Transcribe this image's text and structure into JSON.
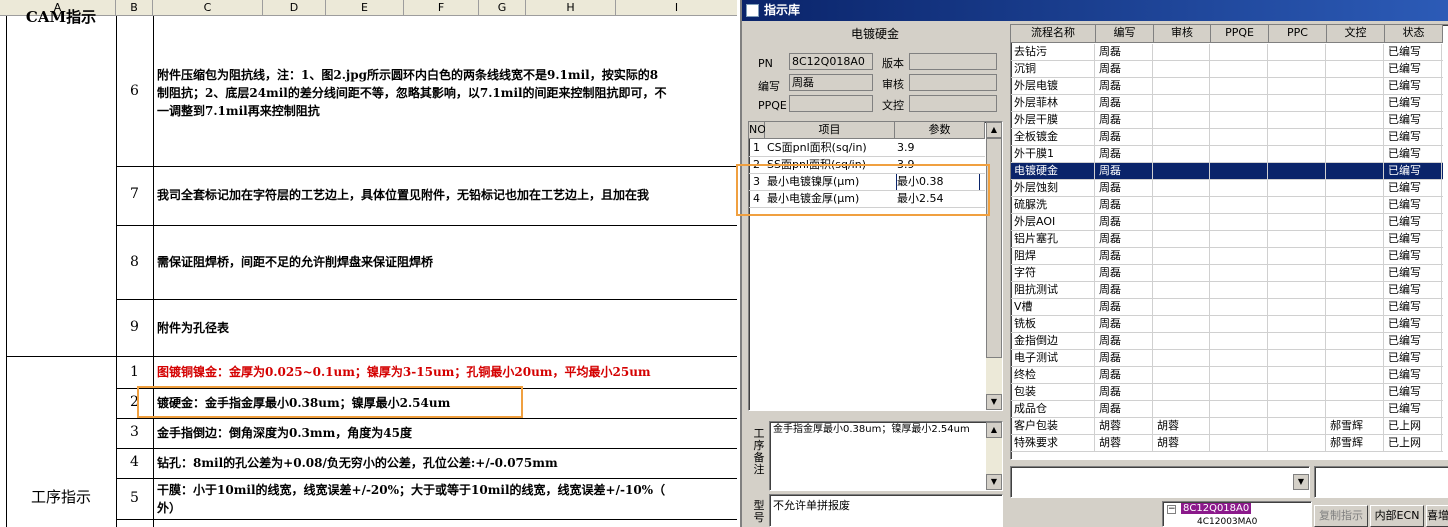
{
  "sheet": {
    "columns": [
      "A",
      "B",
      "C",
      "D",
      "E",
      "F",
      "G",
      "H",
      "I"
    ],
    "top_section_label": "CAM指示",
    "bottom_section_label": "工序指示",
    "upper_rows": [
      {
        "num": "6",
        "line1": "附件压缩包为阻抗线，注：1、图2.jpg所示圆环内白色的两条线线宽不是9.1mil，按实际的8",
        "line2": "制阻抗；2、底层24mil的差分线间距不等，忽略其影响，以7.1mil的间距来控制阻抗即可，不",
        "line3": "一调整到7.1mil再来控制阻抗"
      },
      {
        "num": "7",
        "text": "我司全套标记加在字符层的工艺边上，具体位置见附件，无铅标记也加在工艺边上，且加在我"
      },
      {
        "num": "8",
        "text": "需保证阻焊桥，间距不足的允许削焊盘来保证阻焊桥"
      },
      {
        "num": "9",
        "text": "附件为孔径表"
      }
    ],
    "lower_rows": [
      {
        "num": "1",
        "text": "图镀铜镍金：金厚为0.025~0.1um；镍厚为3-15um；孔铜最小20um，平均最小25um",
        "red": true
      },
      {
        "num": "2",
        "text": "镀硬金：金手指金厚最小0.38um；镍厚最小2.54um"
      },
      {
        "num": "3",
        "text": "金手指倒边：倒角深度为0.3mm，角度为45度"
      },
      {
        "num": "4",
        "text": "钻孔：8mil的孔公差为+0.08/负无穷小的公差，孔位公差:+/-0.075mm"
      },
      {
        "num": "5",
        "text": "干膜：小于10mil的线宽，线宽误差+/-20%；大于或等于10mil的线宽，线宽误差+/-10%（",
        "text2": "外）"
      }
    ]
  },
  "dialog": {
    "title": "指示库",
    "section_title": "电镀硬金",
    "fields": {
      "pn_label": "PN",
      "pn_value": "8C12Q018A0",
      "version_label": "版本",
      "version_value": "",
      "author_label": "编写",
      "author_value": "周磊",
      "review_label": "审核",
      "review_value": "",
      "ppqe_label": "PPQE",
      "ppqe_value": "",
      "control_label": "文控",
      "control_value": ""
    },
    "param_headers": [
      "NO",
      "项目",
      "参数"
    ],
    "params": [
      {
        "no": "1",
        "item": "CS面pnl面积(sq/in)",
        "value": "3.9"
      },
      {
        "no": "2",
        "item": "SS面pnl面积(sq/in)",
        "value": "3.9"
      },
      {
        "no": "3",
        "item": "最小电镀镍厚(μm)",
        "value": "最小0.38"
      },
      {
        "no": "4",
        "item": "最小电镀金厚(μm)",
        "value": "最小2.54"
      }
    ],
    "note_label": "工序备注",
    "note_text": "金手指金厚最小0.38um；镍厚最小2.54um",
    "type_label": "型号",
    "type_text": "不允许单拼报废",
    "flow_headers": [
      "流程名称",
      "编写",
      "审核",
      "PPQE",
      "PPC",
      "文控",
      "状态"
    ],
    "flows": [
      {
        "name": "去钻污",
        "author": "周磊",
        "review": "",
        "ppqe": "",
        "ppc": "",
        "ctrl": "",
        "status": "已编写"
      },
      {
        "name": "沉铜",
        "author": "周磊",
        "review": "",
        "ppqe": "",
        "ppc": "",
        "ctrl": "",
        "status": "已编写"
      },
      {
        "name": "外层电镀",
        "author": "周磊",
        "review": "",
        "ppqe": "",
        "ppc": "",
        "ctrl": "",
        "status": "已编写"
      },
      {
        "name": "外层菲林",
        "author": "周磊",
        "review": "",
        "ppqe": "",
        "ppc": "",
        "ctrl": "",
        "status": "已编写"
      },
      {
        "name": "外层干膜",
        "author": "周磊",
        "review": "",
        "ppqe": "",
        "ppc": "",
        "ctrl": "",
        "status": "已编写"
      },
      {
        "name": "全板镀金",
        "author": "周磊",
        "review": "",
        "ppqe": "",
        "ppc": "",
        "ctrl": "",
        "status": "已编写"
      },
      {
        "name": "外干膜1",
        "author": "周磊",
        "review": "",
        "ppqe": "",
        "ppc": "",
        "ctrl": "",
        "status": "已编写"
      },
      {
        "name": "电镀硬金",
        "author": "周磊",
        "review": "",
        "ppqe": "",
        "ppc": "",
        "ctrl": "",
        "status": "已编写",
        "selected": true
      },
      {
        "name": "外层蚀刻",
        "author": "周磊",
        "review": "",
        "ppqe": "",
        "ppc": "",
        "ctrl": "",
        "status": "已编写"
      },
      {
        "name": "硫脲洗",
        "author": "周磊",
        "review": "",
        "ppqe": "",
        "ppc": "",
        "ctrl": "",
        "status": "已编写"
      },
      {
        "name": "外层AOI",
        "author": "周磊",
        "review": "",
        "ppqe": "",
        "ppc": "",
        "ctrl": "",
        "status": "已编写"
      },
      {
        "name": "铝片塞孔",
        "author": "周磊",
        "review": "",
        "ppqe": "",
        "ppc": "",
        "ctrl": "",
        "status": "已编写"
      },
      {
        "name": "阻焊",
        "author": "周磊",
        "review": "",
        "ppqe": "",
        "ppc": "",
        "ctrl": "",
        "status": "已编写"
      },
      {
        "name": "字符",
        "author": "周磊",
        "review": "",
        "ppqe": "",
        "ppc": "",
        "ctrl": "",
        "status": "已编写"
      },
      {
        "name": "阻抗测试",
        "author": "周磊",
        "review": "",
        "ppqe": "",
        "ppc": "",
        "ctrl": "",
        "status": "已编写"
      },
      {
        "name": "V槽",
        "author": "周磊",
        "review": "",
        "ppqe": "",
        "ppc": "",
        "ctrl": "",
        "status": "已编写"
      },
      {
        "name": "铣板",
        "author": "周磊",
        "review": "",
        "ppqe": "",
        "ppc": "",
        "ctrl": "",
        "status": "已编写"
      },
      {
        "name": "金指倒边",
        "author": "周磊",
        "review": "",
        "ppqe": "",
        "ppc": "",
        "ctrl": "",
        "status": "已编写"
      },
      {
        "name": "电子测试",
        "author": "周磊",
        "review": "",
        "ppqe": "",
        "ppc": "",
        "ctrl": "",
        "status": "已编写"
      },
      {
        "name": "终检",
        "author": "周磊",
        "review": "",
        "ppqe": "",
        "ppc": "",
        "ctrl": "",
        "status": "已编写"
      },
      {
        "name": "包装",
        "author": "周磊",
        "review": "",
        "ppqe": "",
        "ppc": "",
        "ctrl": "",
        "status": "已编写"
      },
      {
        "name": "成品仓",
        "author": "周磊",
        "review": "",
        "ppqe": "",
        "ppc": "",
        "ctrl": "",
        "status": "已编写"
      },
      {
        "name": "客户包装",
        "author": "胡蓉",
        "review": "胡蓉",
        "ppqe": "",
        "ppc": "",
        "ctrl": "郝雪辉",
        "status": "已上网"
      },
      {
        "name": "特殊要求",
        "author": "胡蓉",
        "review": "胡蓉",
        "ppqe": "",
        "ppc": "",
        "ctrl": "郝雪辉",
        "status": "已上网"
      }
    ],
    "tree": {
      "root": "8C12Q018A0",
      "child": "4C12003MA0"
    },
    "buttons": {
      "copy": "复制指示",
      "internal_ecn": "内部ECN",
      "next": "喜增"
    },
    "colors": {
      "selection": "#0a246a",
      "tree_highlight": "#8b1a8b",
      "title_start": "#0a246a",
      "annotation": "#f0a040"
    }
  }
}
